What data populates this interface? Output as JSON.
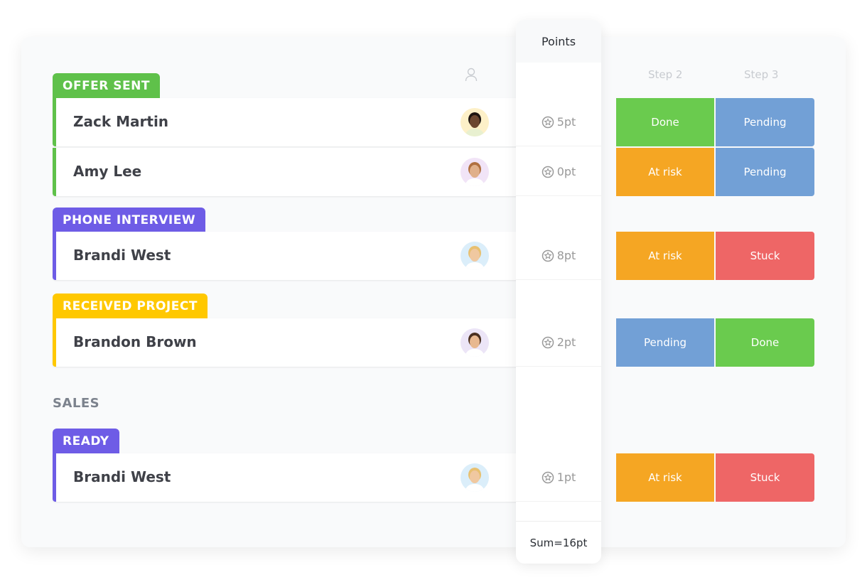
{
  "header": {
    "step2": "Step 2",
    "step3": "Step 3",
    "points": "Points",
    "assignee_icon": "person-icon"
  },
  "colors": {
    "offer_sent": "#5fc14a",
    "phone_interview": "#6e5ce6",
    "received_project": "#ffc800",
    "ready": "#6e5ce6",
    "Done": "#6acb4e",
    "Pending": "#72a0d6",
    "At risk": "#f5a623",
    "Stuck": "#ee6666"
  },
  "groups": [
    {
      "label": "OFFER SENT"
    },
    {
      "label": "PHONE INTERVIEW"
    },
    {
      "label": "RECEIVED PROJECT"
    },
    {
      "label": "READY"
    }
  ],
  "section": "SALES",
  "rows": [
    {
      "name": "Zack Martin",
      "points": "5pt",
      "step2": "Done",
      "step3": "Pending"
    },
    {
      "name": "Amy Lee",
      "points": "0pt",
      "step2": "At risk",
      "step3": "Pending"
    },
    {
      "name": "Brandi West",
      "points": "8pt",
      "step2": "At risk",
      "step3": "Stuck"
    },
    {
      "name": "Brandon Brown",
      "points": "2pt",
      "step2": "Pending",
      "step3": "Done"
    },
    {
      "name": "Brandi West",
      "points": "1pt",
      "step2": "At risk",
      "step3": "Stuck"
    }
  ],
  "sum": "Sum=16pt"
}
